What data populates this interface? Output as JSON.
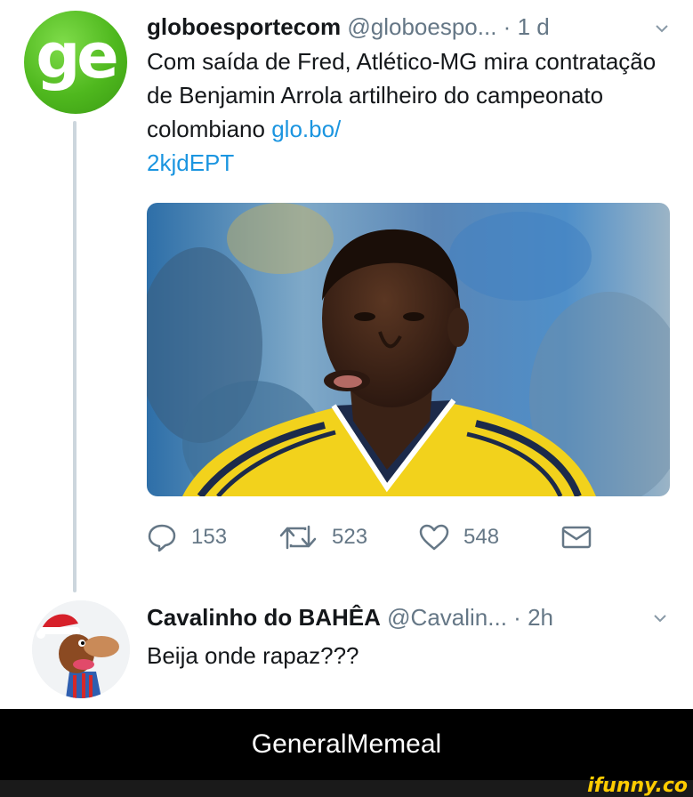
{
  "tweet": {
    "avatar_text": "ge",
    "name": "globoesportecom",
    "handle": "@globoespo...",
    "time_sep": "·",
    "time": "1 d",
    "text": "Com saída de Fred, Atlético-MG mira contratação de Benjamin Arrola artilheiro do campeonato colombiano ",
    "link": "glo.bo/\n2kjdEPT",
    "actions": {
      "replies": "153",
      "retweets": "523",
      "likes": "548"
    }
  },
  "reply": {
    "name": "Cavalinho do BAHÊA",
    "handle": "@Cavalin...",
    "time_sep": "·",
    "time": "2h",
    "text": "Beija onde rapaz???"
  },
  "banner": {
    "text": "GeneralMemeal"
  },
  "watermark": {
    "text": "ifunny.co"
  },
  "colors": {
    "link": "#1b95e0",
    "secondary": "#657786",
    "avatar_green": "#4fb81e",
    "jersey_yellow": "#f2d21c",
    "watermark": "#ffcc00"
  }
}
